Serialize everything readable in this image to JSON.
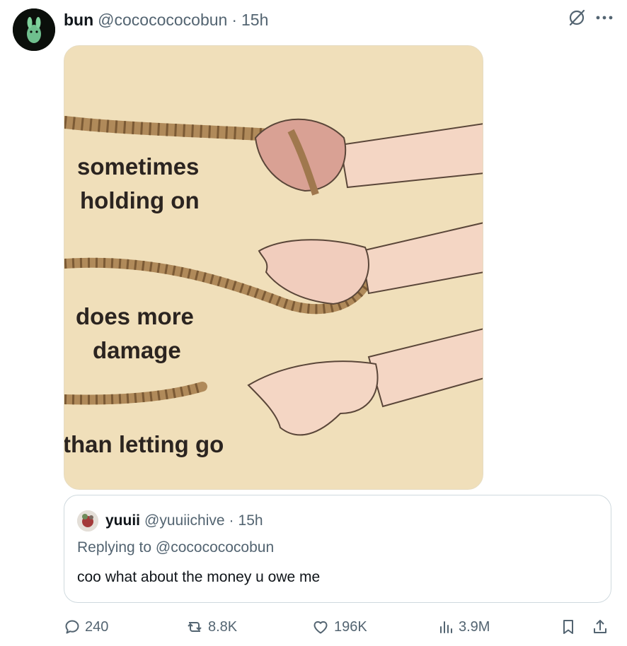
{
  "tweet": {
    "author_name": "bun",
    "author_handle": "@cococococobun",
    "separator": "·",
    "time": "15h"
  },
  "top_icons": [
    "grok-icon",
    "more-icon"
  ],
  "media": {
    "lines": [
      "sometimes",
      "holding on",
      "does more",
      "damage",
      "than letting go"
    ]
  },
  "quote": {
    "author_name": "yuuii",
    "author_handle": "@yuuiichive",
    "separator": "·",
    "time": "15h",
    "replying_to": "Replying to @cococococobun",
    "text": "coo what about the money u owe me"
  },
  "actions": {
    "replies": "240",
    "reposts": "8.8K",
    "likes": "196K",
    "views": "3.9M"
  },
  "colors": {
    "text_primary": "#0f1419",
    "text_secondary": "#536471",
    "border": "#cfd9de",
    "meme_background": "#f0dfba"
  }
}
